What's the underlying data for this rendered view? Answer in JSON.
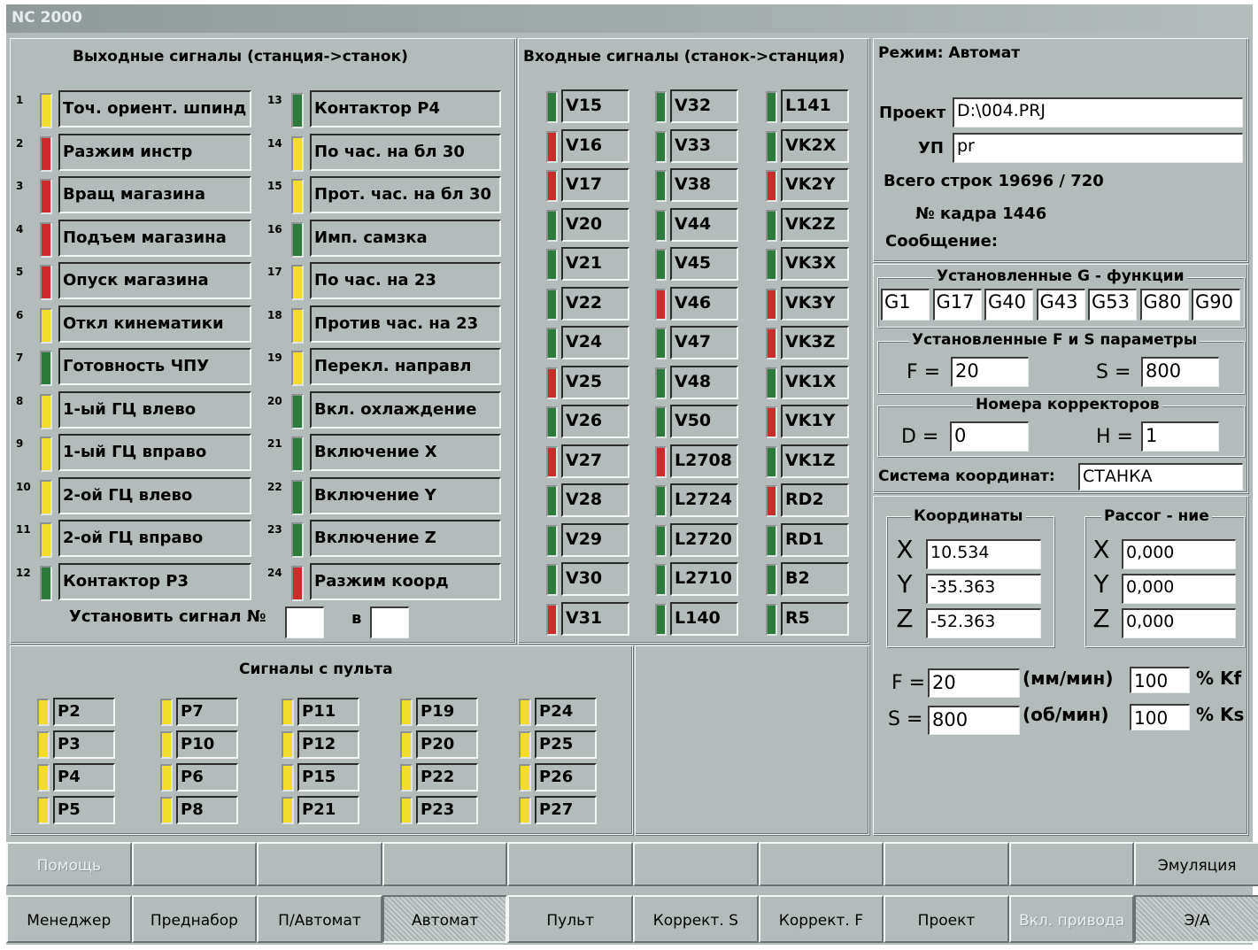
{
  "app_title": "NC 2000",
  "outputs": {
    "title": "Выходные сигналы (станция->станок)",
    "left": [
      {
        "n": "1",
        "label": "Точ. ориент. шпинд",
        "color": "yellow"
      },
      {
        "n": "2",
        "label": "Разжим инстр",
        "color": "red"
      },
      {
        "n": "3",
        "label": "Вращ магазина",
        "color": "red"
      },
      {
        "n": "4",
        "label": "Подъем магазина",
        "color": "red"
      },
      {
        "n": "5",
        "label": "Опуск магазина",
        "color": "red"
      },
      {
        "n": "6",
        "label": "Откл кинематики",
        "color": "yellow"
      },
      {
        "n": "7",
        "label": "Готовность ЧПУ",
        "color": "green"
      },
      {
        "n": "8",
        "label": "1-ый ГЦ влево",
        "color": "yellow"
      },
      {
        "n": "9",
        "label": "1-ый ГЦ вправо",
        "color": "yellow"
      },
      {
        "n": "10",
        "label": "2-ой ГЦ влево",
        "color": "yellow"
      },
      {
        "n": "11",
        "label": "2-ой ГЦ вправо",
        "color": "yellow"
      },
      {
        "n": "12",
        "label": "Контактор Р3",
        "color": "green"
      }
    ],
    "right": [
      {
        "n": "13",
        "label": "Контактор Р4",
        "color": "green"
      },
      {
        "n": "14",
        "label": "По час. на бл 30",
        "color": "yellow"
      },
      {
        "n": "15",
        "label": "Прот. час. на бл 30",
        "color": "yellow"
      },
      {
        "n": "16",
        "label": "Имп. самзка",
        "color": "green"
      },
      {
        "n": "17",
        "label": "По час. на 23",
        "color": "yellow"
      },
      {
        "n": "18",
        "label": "Против час. на 23",
        "color": "yellow"
      },
      {
        "n": "19",
        "label": "Перекл. направл",
        "color": "yellow"
      },
      {
        "n": "20",
        "label": "Вкл. охлаждение",
        "color": "green"
      },
      {
        "n": "21",
        "label": "Включение X",
        "color": "green"
      },
      {
        "n": "22",
        "label": "Включение Y",
        "color": "green"
      },
      {
        "n": "23",
        "label": "Включение Z",
        "color": "green"
      },
      {
        "n": "24",
        "label": "Разжим коорд",
        "color": "red"
      }
    ],
    "set_label": "Установить сигнал №",
    "set_in": "в"
  },
  "inputs": {
    "title": "Входные сигналы (станок->станция)",
    "cols": [
      [
        {
          "label": "V15",
          "color": "green"
        },
        {
          "label": "V16",
          "color": "red"
        },
        {
          "label": "V17",
          "color": "red"
        },
        {
          "label": "V20",
          "color": "green"
        },
        {
          "label": "V21",
          "color": "green"
        },
        {
          "label": "V22",
          "color": "green"
        },
        {
          "label": "V24",
          "color": "green"
        },
        {
          "label": "V25",
          "color": "red"
        },
        {
          "label": "V26",
          "color": "green"
        },
        {
          "label": "V27",
          "color": "red"
        },
        {
          "label": "V28",
          "color": "green"
        },
        {
          "label": "V29",
          "color": "green"
        },
        {
          "label": "V30",
          "color": "green"
        },
        {
          "label": "V31",
          "color": "red"
        }
      ],
      [
        {
          "label": "V32",
          "color": "green"
        },
        {
          "label": "V33",
          "color": "green"
        },
        {
          "label": "V38",
          "color": "green"
        },
        {
          "label": "V44",
          "color": "green"
        },
        {
          "label": "V45",
          "color": "green"
        },
        {
          "label": "V46",
          "color": "red"
        },
        {
          "label": "V47",
          "color": "green"
        },
        {
          "label": "V48",
          "color": "green"
        },
        {
          "label": "V50",
          "color": "green"
        },
        {
          "label": "L2708",
          "color": "red"
        },
        {
          "label": "L2724",
          "color": "green"
        },
        {
          "label": "L2720",
          "color": "green"
        },
        {
          "label": "L2710",
          "color": "green"
        },
        {
          "label": "L140",
          "color": "green"
        }
      ],
      [
        {
          "label": "L141",
          "color": "green"
        },
        {
          "label": "VK2X",
          "color": "green"
        },
        {
          "label": "VK2Y",
          "color": "red"
        },
        {
          "label": "VK2Z",
          "color": "green"
        },
        {
          "label": "VK3X",
          "color": "green"
        },
        {
          "label": "VK3Y",
          "color": "red"
        },
        {
          "label": "VK3Z",
          "color": "red"
        },
        {
          "label": "VK1X",
          "color": "green"
        },
        {
          "label": "VK1Y",
          "color": "red"
        },
        {
          "label": "VK1Z",
          "color": "green"
        },
        {
          "label": "RD2",
          "color": "red"
        },
        {
          "label": "RD1",
          "color": "green"
        },
        {
          "label": "B2",
          "color": "green"
        },
        {
          "label": "R5",
          "color": "green"
        }
      ]
    ]
  },
  "panel_signals": {
    "title": "Сигналы с пульта",
    "cols": [
      [
        "P2",
        "P3",
        "P4",
        "P5"
      ],
      [
        "P7",
        "P10",
        "P6",
        "P8"
      ],
      [
        "P11",
        "P12",
        "P15",
        "P21"
      ],
      [
        "P19",
        "P20",
        "P22",
        "P23"
      ],
      [
        "P24",
        "P25",
        "P26",
        "P27"
      ]
    ],
    "color": "yellow"
  },
  "status": {
    "mode": "Режим: Автомат",
    "project_label": "Проект",
    "project_value": "D:\\004.PRJ",
    "up_label": "УП",
    "up_value": "pr",
    "total": "Всего строк 19696 / 720",
    "frame": "№ кадра  1446",
    "message": "Сообщение:"
  },
  "gfunc": {
    "title": "Установленные G - функции",
    "items": [
      "G1",
      "G17",
      "G40",
      "G43",
      "G53",
      "G80",
      "G90"
    ]
  },
  "fs": {
    "title": "Установленные F и S параметры",
    "f_label": "F =",
    "f_value": "20",
    "s_label": "S =",
    "s_value": "800"
  },
  "corr": {
    "title": "Номера корректоров",
    "d_label": "D =",
    "d_value": "0",
    "h_label": "H =",
    "h_value": "1"
  },
  "cs": {
    "label": "Система координат:",
    "value": "СТАНКА"
  },
  "coords": {
    "title": "Координаты",
    "x": "10.534",
    "y": "-35.363",
    "z": "-52.363"
  },
  "mismatch": {
    "title": "Рассог - ние",
    "x": "0,000",
    "y": "0,000",
    "z": "0,000"
  },
  "axes": [
    "X",
    "Y",
    "Z"
  ],
  "feed": {
    "f_label": "F =",
    "f_value": "20",
    "f_unit": "(мм/мин)",
    "kf_value": "100",
    "kf_label": "% Kf",
    "s_label": "S =",
    "s_value": "800",
    "s_unit": "(об/мин)",
    "ks_value": "100",
    "ks_label": "% Ks"
  },
  "fkeys_top": [
    "Помощь",
    "",
    "",
    "",
    "",
    "",
    "",
    "",
    "",
    "Эмуляция"
  ],
  "fkeys_bottom": [
    "Менеджер",
    "Преднабор",
    "П/Автомат",
    "Автомат",
    "Пульт",
    "Коррект. S",
    "Коррект. F",
    "Проект",
    "Вкл. привода",
    "Э/А"
  ]
}
